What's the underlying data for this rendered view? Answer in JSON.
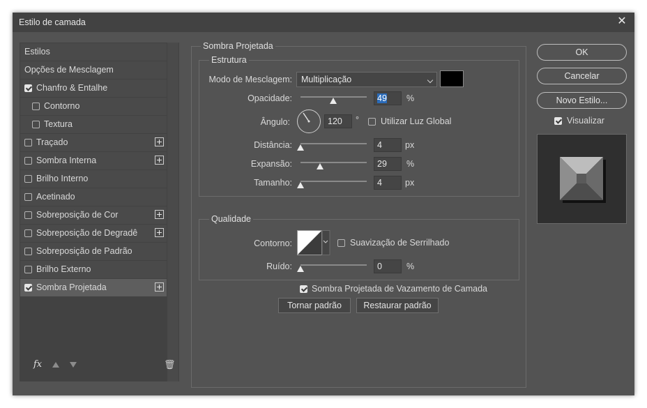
{
  "window": {
    "title": "Estilo de camada"
  },
  "styles_list": {
    "items": [
      {
        "label": "Estilos",
        "has_checkbox": false,
        "checked": false,
        "has_plus": false,
        "indent": false,
        "active": false
      },
      {
        "label": "Opções de Mesclagem",
        "has_checkbox": false,
        "checked": false,
        "has_plus": false,
        "indent": false,
        "active": false
      },
      {
        "label": "Chanfro & Entalhe",
        "has_checkbox": true,
        "checked": true,
        "has_plus": false,
        "indent": false,
        "active": false
      },
      {
        "label": "Contorno",
        "has_checkbox": true,
        "checked": false,
        "has_plus": false,
        "indent": true,
        "active": false
      },
      {
        "label": "Textura",
        "has_checkbox": true,
        "checked": false,
        "has_plus": false,
        "indent": true,
        "active": false
      },
      {
        "label": "Traçado",
        "has_checkbox": true,
        "checked": false,
        "has_plus": true,
        "indent": false,
        "active": false
      },
      {
        "label": "Sombra Interna",
        "has_checkbox": true,
        "checked": false,
        "has_plus": true,
        "indent": false,
        "active": false
      },
      {
        "label": "Brilho Interno",
        "has_checkbox": true,
        "checked": false,
        "has_plus": false,
        "indent": false,
        "active": false
      },
      {
        "label": "Acetinado",
        "has_checkbox": true,
        "checked": false,
        "has_plus": false,
        "indent": false,
        "active": false
      },
      {
        "label": "Sobreposição de Cor",
        "has_checkbox": true,
        "checked": false,
        "has_plus": true,
        "indent": false,
        "active": false
      },
      {
        "label": "Sobreposição de Degradê",
        "has_checkbox": true,
        "checked": false,
        "has_plus": true,
        "indent": false,
        "active": false
      },
      {
        "label": "Sobreposição de Padrão",
        "has_checkbox": true,
        "checked": false,
        "has_plus": false,
        "indent": false,
        "active": false
      },
      {
        "label": "Brilho Externo",
        "has_checkbox": true,
        "checked": false,
        "has_plus": false,
        "indent": false,
        "active": false
      },
      {
        "label": "Sombra Projetada",
        "has_checkbox": true,
        "checked": true,
        "has_plus": true,
        "indent": false,
        "active": true
      }
    ],
    "fx_label": "fx"
  },
  "drop_shadow": {
    "section_title": "Sombra Projetada",
    "structure": {
      "title": "Estrutura",
      "blend_mode_label": "Modo de Mesclagem:",
      "blend_mode_value": "Multiplicação",
      "shadow_color": "#000000",
      "opacity_label": "Opacidade:",
      "opacity_value": "49",
      "opacity_unit": "%",
      "opacity_level": 0.49,
      "angle_label": "Ângulo:",
      "angle_value": "120",
      "angle_unit": "°",
      "global_light_label": "Utilizar Luz Global",
      "global_light_checked": false,
      "distance_label": "Distância:",
      "distance_value": "4",
      "distance_unit": "px",
      "distance_level": 0.0,
      "spread_label": "Expansão:",
      "spread_value": "29",
      "spread_unit": "%",
      "spread_level": 0.29,
      "size_label": "Tamanho:",
      "size_value": "4",
      "size_unit": "px",
      "size_level": 0.0
    },
    "quality": {
      "title": "Qualidade",
      "contour_label": "Contorno:",
      "antialias_label": "Suavização de Serrilhado",
      "antialias_checked": false,
      "noise_label": "Ruído:",
      "noise_value": "0",
      "noise_unit": "%",
      "noise_level": 0.0
    },
    "knockout_label": "Sombra Projetada de Vazamento de Camada",
    "knockout_checked": true,
    "make_default_label": "Tornar padrão",
    "reset_default_label": "Restaurar padrão"
  },
  "actions": {
    "ok_label": "OK",
    "cancel_label": "Cancelar",
    "new_style_label": "Novo Estilo...",
    "preview_label": "Visualizar",
    "preview_checked": true
  }
}
